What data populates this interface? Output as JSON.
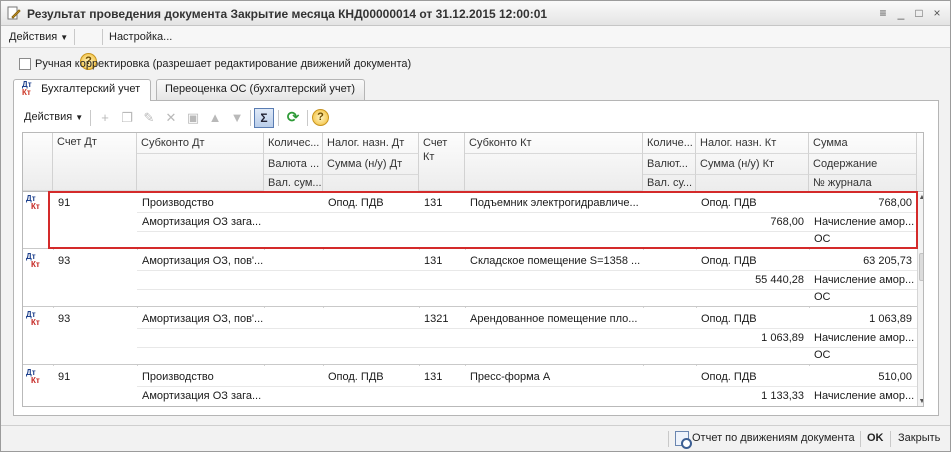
{
  "window": {
    "title": "Результат проведения документа Закрытие месяца КНД00000014 от 31.12.2015 12:00:01",
    "icon": "document-edit-icon",
    "controls": [
      "≡",
      "_",
      "□",
      "×"
    ]
  },
  "menu": {
    "actions_label": "Действия",
    "help_label": "?",
    "settings_label": "Настройка..."
  },
  "manual_correction": {
    "checked": false,
    "label": "Ручная корректировка (разрешает редактирование движений документа)"
  },
  "tabs": [
    {
      "label": "Бухгалтерский учет",
      "icon": "dt-kt-icon",
      "active": true
    },
    {
      "label": "Переоценка ОС (бухгалтерский учет)",
      "active": false
    }
  ],
  "tab_icon_text": {
    "dt": "Дт",
    "kt": "Кт"
  },
  "toolbar": {
    "actions_label": "Действия",
    "add_icon": "+",
    "copy_icon": "❐",
    "edit_icon": "✎",
    "delete_icon": "✕",
    "save_icon": "▣",
    "up_icon": "▲",
    "down_icon": "▼",
    "sum_label": "Σ",
    "refresh_icon": "⟳",
    "help_label": "?"
  },
  "grid": {
    "headers": {
      "account_dt": "Счет Дт",
      "subconto_dt": "Субконто Дт",
      "qty_dt": "Количес...",
      "currency_dt": "Валюта ...",
      "cur_sum_dt": "Вал. сум...",
      "tax_dt": "Налог. назн. Дт",
      "sum_nu_dt": "Сумма (н/у) Дт",
      "account_kt_1": "Счет",
      "account_kt_2": "Кт",
      "subconto_kt": "Субконто Кт",
      "qty_kt": "Количе...",
      "currency_kt": "Валют...",
      "cur_sum_kt": "Вал. су...",
      "tax_kt": "Налог. назн. Кт",
      "sum_nu_kt": "Сумма (н/у) Кт",
      "amount": "Сумма",
      "content": "Содержание",
      "journal": "№ журнала"
    },
    "rows": [
      {
        "account_dt": "91",
        "subconto_dt_1": "Производство",
        "subconto_dt_2": "Амортизация ОЗ зага...",
        "tax_dt": "Опод. ПДВ",
        "sum_nu_dt": "",
        "account_kt": "131",
        "subconto_kt": "Подъемник электрогидравличе...",
        "tax_kt": "Опод. ПДВ",
        "sum_nu_kt": "768,00",
        "amount": "768,00",
        "content": "Начисление амор...",
        "journal": "ОС"
      },
      {
        "account_dt": "93",
        "subconto_dt_1": "Амортизация ОЗ, пов'...",
        "subconto_dt_2": "",
        "tax_dt": "",
        "sum_nu_dt": "",
        "account_kt": "131",
        "subconto_kt": "Складское помещение S=1358 ...",
        "tax_kt": "Опод. ПДВ",
        "sum_nu_kt": "55 440,28",
        "amount": "63 205,73",
        "content": "Начисление амор...",
        "journal": "ОС"
      },
      {
        "account_dt": "93",
        "subconto_dt_1": "Амортизация ОЗ, пов'...",
        "subconto_dt_2": "",
        "tax_dt": "",
        "sum_nu_dt": "",
        "account_kt": "1321",
        "subconto_kt": "Арендованное помещение пло...",
        "tax_kt": "Опод. ПДВ",
        "sum_nu_kt": "1 063,89",
        "amount": "1 063,89",
        "content": "Начисление амор...",
        "journal": "ОС"
      },
      {
        "account_dt": "91",
        "subconto_dt_1": "Производство",
        "subconto_dt_2": "Амортизация ОЗ зага...",
        "tax_dt": "Опод. ПДВ",
        "sum_nu_dt": "",
        "account_kt": "131",
        "subconto_kt": "Пресс-форма А",
        "tax_kt": "Опод. ПДВ",
        "sum_nu_kt": "1 133,33",
        "amount": "510,00",
        "content": "Начисление амор...",
        "journal": ""
      }
    ],
    "row_icon": {
      "dt": "Дт",
      "kt": "Кт"
    },
    "highlight_color": "#d42a2a"
  },
  "statusbar": {
    "report_label": "Отчет по движениям документа",
    "ok_label": "OK",
    "close_label": "Закрыть"
  }
}
